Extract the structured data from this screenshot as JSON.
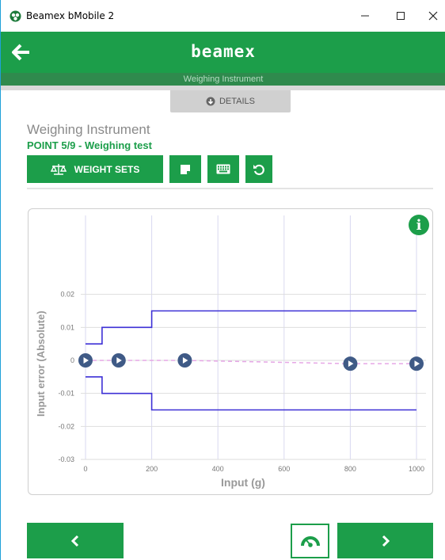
{
  "window": {
    "title": "Beamex bMobile 2",
    "icon": "beamex-app-icon",
    "minimize_glyph": "—",
    "maximize_glyph": "☐",
    "close_glyph": "✕"
  },
  "header": {
    "logo_text": "beamex",
    "subtitle": "Weighing Instrument",
    "back_icon": "arrow-left-icon"
  },
  "details_tab": {
    "label": "DETAILS",
    "icon": "chevron-circle-down-icon"
  },
  "instrument": {
    "name": "Weighing Instrument",
    "point_label": "POINT 5/9 - Weighing test"
  },
  "toolbar": {
    "weight_sets_label": "WEIGHT SETS",
    "weight_sets_icon": "balance-scale-icon",
    "note_icon": "note-icon",
    "keyboard_icon": "keyboard-icon",
    "undo_icon": "undo-icon"
  },
  "colors": {
    "brand_green": "#1c9e4a",
    "dark_green": "#2f8a4d",
    "limit_line": "#3d30d6",
    "marker": "#3f5a86",
    "trend_line": "#e6a7e6"
  },
  "chart_data": {
    "type": "line",
    "xlabel": "Input (g)",
    "ylabel": "Input error (Absolute)",
    "xlim": [
      0,
      1000
    ],
    "ylim": [
      -0.03,
      0.03
    ],
    "x_ticks": [
      "0",
      "200",
      "400",
      "600",
      "800",
      "1000"
    ],
    "x_tick_values": [
      0,
      200,
      400,
      600,
      800,
      1000
    ],
    "y_ticks": [
      "0.02",
      "0.01",
      "0",
      "-0.01",
      "-0.02",
      "-0.03"
    ],
    "y_tick_values": [
      0.02,
      0.01,
      0,
      -0.01,
      -0.02,
      -0.03
    ],
    "grid": true,
    "series": [
      {
        "role": "upper-limit",
        "points": [
          [
            0,
            0.005
          ],
          [
            50,
            0.005
          ],
          [
            50,
            0.01
          ],
          [
            200,
            0.01
          ],
          [
            200,
            0.015
          ],
          [
            1000,
            0.015
          ]
        ]
      },
      {
        "role": "lower-limit",
        "points": [
          [
            0,
            -0.005
          ],
          [
            50,
            -0.005
          ],
          [
            50,
            -0.01
          ],
          [
            200,
            -0.01
          ],
          [
            200,
            -0.015
          ],
          [
            1000,
            -0.015
          ]
        ]
      },
      {
        "role": "measured-points",
        "points": [
          [
            0,
            0
          ],
          [
            100,
            0
          ],
          [
            300,
            0
          ],
          [
            800,
            -0.001
          ],
          [
            1000,
            -0.001
          ]
        ]
      }
    ]
  },
  "info_icon": "info-circle-icon",
  "footer": {
    "prev_icon": "chevron-left-icon",
    "next_icon": "chevron-right-icon",
    "gauge_icon": "gauge-icon"
  }
}
